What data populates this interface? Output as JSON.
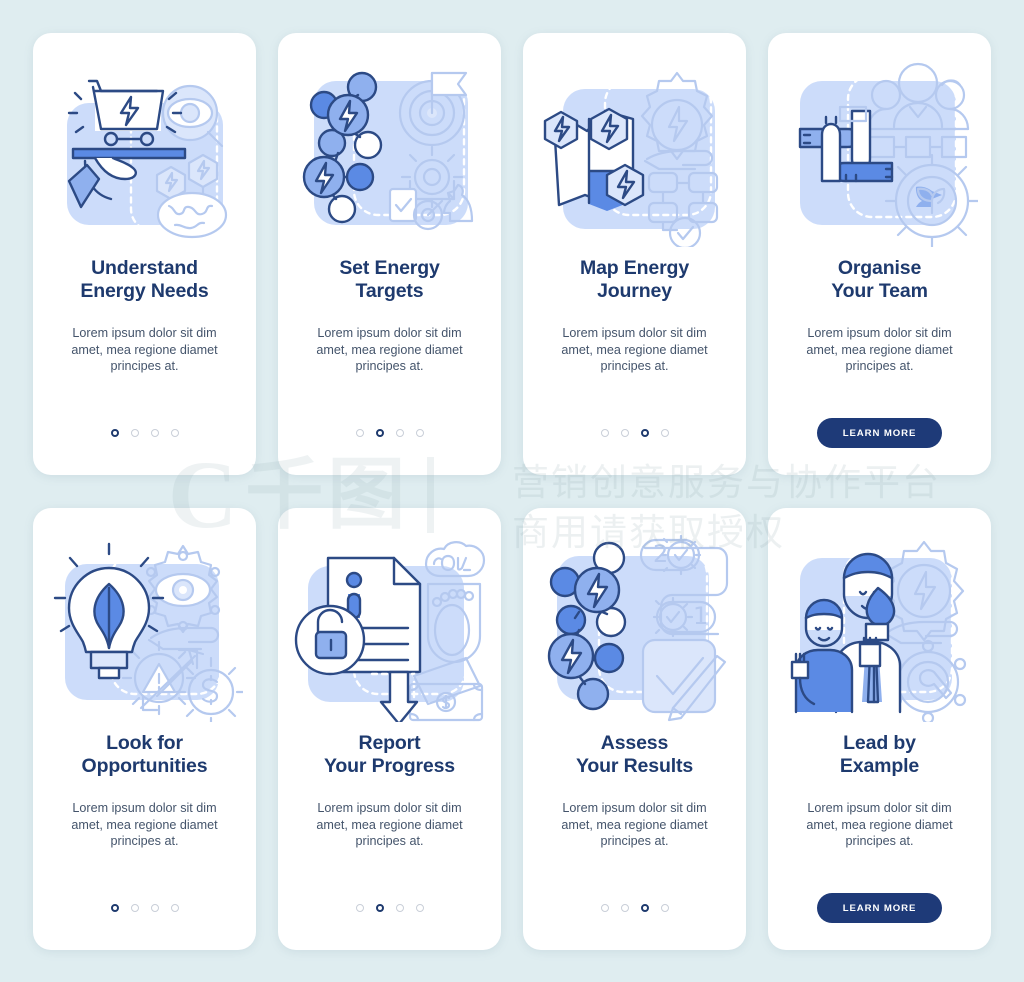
{
  "theme": {
    "page_background": "#dfedf0",
    "card_background": "#ffffff",
    "title_color": "#1e3a6e",
    "body_color": "#44546b",
    "accent_button": "#1e3a78",
    "illustration_blue": "#ccdcfa",
    "dot_active": "#1e3a6e",
    "dot_inactive": "#c9cfd8"
  },
  "watermark": {
    "logo_letter": "C",
    "logo_text": "千图",
    "line1": "营销创意服务与协作平台",
    "line2": "商用请获取授权"
  },
  "shared": {
    "description": "Lorem ipsum dolor sit dim amet, mea regione diamet principes at.",
    "learn_more_label": "LEARN MORE",
    "dot_count": 4
  },
  "screens": [
    {
      "id": "understand-energy-needs",
      "title_line1": "Understand",
      "title_line2": "Energy Needs",
      "description": "Lorem ipsum dolor sit dim amet, mea regione diamet principes at.",
      "footer_type": "dots",
      "active_dot": 1,
      "illustration": "hand-tray-energy-cart-magnifier-globe"
    },
    {
      "id": "set-energy-targets",
      "title_line1": "Set Energy",
      "title_line2": "Targets",
      "description": "Lorem ipsum dolor sit dim amet, mea regione diamet principes at.",
      "footer_type": "dots",
      "active_dot": 2,
      "illustration": "network-energy-nodes-target-flag-gear-chess"
    },
    {
      "id": "map-energy-journey",
      "title_line1": "Map Energy",
      "title_line2": "Journey",
      "description": "Lorem ipsum dolor sit dim amet, mea regione diamet principes at.",
      "footer_type": "dots",
      "active_dot": 3,
      "illustration": "map-energy-hexagons-gear-hand-flowchart-check"
    },
    {
      "id": "organise-your-team",
      "title_line1": "Organise",
      "title_line2": "Your Team",
      "description": "Lorem ipsum dolor sit dim amet, mea regione diamet principes at.",
      "footer_type": "button",
      "button_label": "LEARN MORE",
      "illustration": "interlocking-hands-team-gear-leaf"
    },
    {
      "id": "look-for-opportunities",
      "title_line1": "Look for",
      "title_line2": "Opportunities",
      "description": "Lorem ipsum dolor sit dim amet, mea regione diamet principes at.",
      "footer_type": "dots",
      "active_dot": 1,
      "illustration": "lightbulb-leaf-eye-gear-hand-arrows-dollar"
    },
    {
      "id": "report-your-progress",
      "title_line1": "Report",
      "title_line2": "Your Progress",
      "description": "Lorem ipsum dolor sit dim amet, mea regione diamet principes at.",
      "footer_type": "dots",
      "active_dot": 2,
      "illustration": "document-unlock-co2-footprint-money-arrow-down"
    },
    {
      "id": "assess-your-results",
      "title_line1": "Assess",
      "title_line2": "Your Results",
      "description": "Lorem ipsum dolor sit dim amet, mea regione diamet principes at.",
      "footer_type": "dots",
      "active_dot": 3,
      "illustration": "network-energy-nodes-steps-checkbox-pen"
    },
    {
      "id": "lead-by-example",
      "title_line1": "Lead by",
      "title_line2": "Example",
      "description": "Lorem ipsum dolor sit dim amet, mea regione diamet principes at.",
      "footer_type": "button",
      "button_label": "LEARN MORE",
      "illustration": "people-torch-gear-energy-hand-wrench"
    }
  ]
}
